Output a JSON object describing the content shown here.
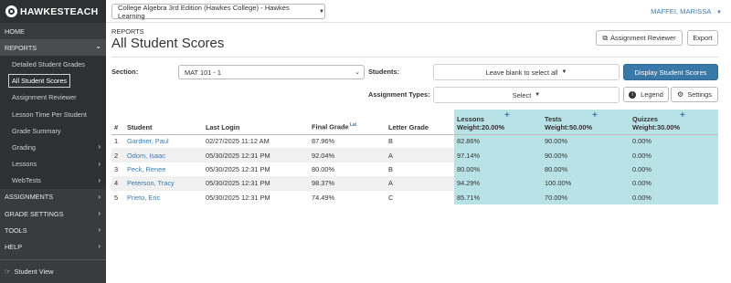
{
  "header": {
    "brand": "HAWKESTEACH",
    "course": "College Algebra 3rd Edition (Hawkes College) - Hawkes Learning",
    "user": "MAFFEI, MARISSA"
  },
  "sidebar": {
    "home": "HOME",
    "reports": "REPORTS",
    "report_items": [
      "Detailed Student Grades",
      "All Student Scores",
      "Assignment Reviewer",
      "Lesson Time Per Student",
      "Grade Summary",
      "Grading",
      "Lessons",
      "WebTests"
    ],
    "bottom_items": [
      "ASSIGNMENTS",
      "GRADE SETTINGS",
      "TOOLS",
      "HELP"
    ],
    "footer": "Student View"
  },
  "page": {
    "breadcrumb": "REPORTS",
    "title": "All Student Scores",
    "assignment_reviewer_btn": "Assignment Reviewer",
    "export_btn": "Export"
  },
  "filters": {
    "section_label": "Section:",
    "section_value": "MAT 101 - 1",
    "students_label": "Students:",
    "students_value": "Leave blank to select all",
    "display_btn": "Display Student Scores",
    "types_label": "Assignment Types:",
    "types_value": "Select",
    "legend_btn": "Legend",
    "settings_btn": "Settings"
  },
  "table": {
    "headers": {
      "num": "#",
      "student": "Student",
      "last_login": "Last Login",
      "final_grade": "Final Grade",
      "final_grade_sup": "Lat",
      "letter_grade": "Letter Grade",
      "lessons": "Lessons",
      "lessons_weight": "Weight:20.00%",
      "tests": "Tests",
      "tests_weight": "Weight:50.00%",
      "quizzes": "Quizzes",
      "quizzes_weight": "Weight:30.00%"
    },
    "rows": [
      {
        "num": "1",
        "student": "Gardner, Paul",
        "last_login": "02/27/2025 11:12 AM",
        "final": "87.96%",
        "letter": "B",
        "lessons": "82.86%",
        "tests": "90.00%",
        "quizzes": "0.00%"
      },
      {
        "num": "2",
        "student": "Odom, Isaac",
        "last_login": "05/30/2025 12:31 PM",
        "final": "92.04%",
        "letter": "A",
        "lessons": "97.14%",
        "tests": "90.00%",
        "quizzes": "0.00%"
      },
      {
        "num": "3",
        "student": "Peck, Renee",
        "last_login": "05/30/2025 12:31 PM",
        "final": "80.00%",
        "letter": "B",
        "lessons": "80.00%",
        "tests": "80.00%",
        "quizzes": "0.00%"
      },
      {
        "num": "4",
        "student": "Peterson, Tracy",
        "last_login": "05/30/2025 12:31 PM",
        "final": "98.37%",
        "letter": "A",
        "lessons": "94.29%",
        "tests": "100.00%",
        "quizzes": "0.00%"
      },
      {
        "num": "5",
        "student": "Prieto, Eric",
        "last_login": "05/30/2025 12:31 PM",
        "final": "74.49%",
        "letter": "C",
        "lessons": "85.71%",
        "tests": "70.00%",
        "quizzes": "0.00%"
      }
    ]
  }
}
